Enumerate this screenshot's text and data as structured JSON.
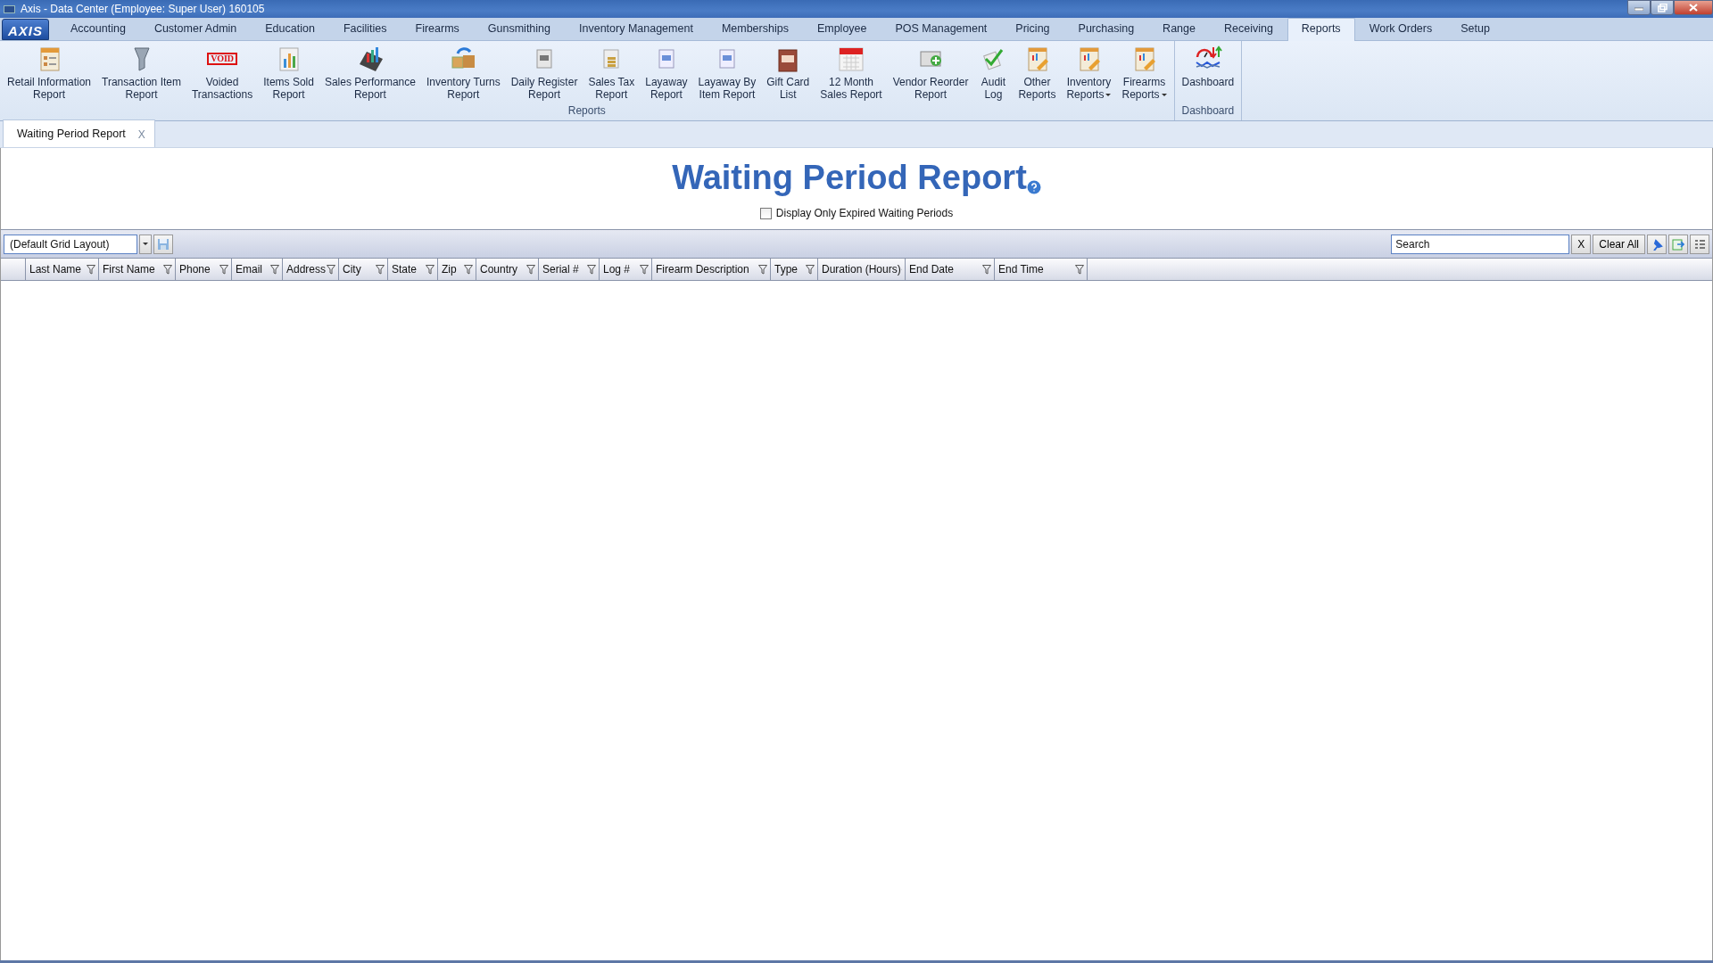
{
  "window": {
    "title": "Axis - Data Center  (Employee: Super User) 160105",
    "logo": "AXIS"
  },
  "menu_tabs": [
    {
      "label": "Accounting",
      "selected": false
    },
    {
      "label": "Customer Admin",
      "selected": false
    },
    {
      "label": "Education",
      "selected": false
    },
    {
      "label": "Facilities",
      "selected": false
    },
    {
      "label": "Firearms",
      "selected": false
    },
    {
      "label": "Gunsmithing",
      "selected": false
    },
    {
      "label": "Inventory Management",
      "selected": false
    },
    {
      "label": "Memberships",
      "selected": false
    },
    {
      "label": "Employee",
      "selected": false
    },
    {
      "label": "POS Management",
      "selected": false
    },
    {
      "label": "Pricing",
      "selected": false
    },
    {
      "label": "Purchasing",
      "selected": false
    },
    {
      "label": "Range",
      "selected": false
    },
    {
      "label": "Receiving",
      "selected": false
    },
    {
      "label": "Reports",
      "selected": true
    },
    {
      "label": "Work Orders",
      "selected": false
    },
    {
      "label": "Setup",
      "selected": false
    }
  ],
  "ribbon_groups": [
    {
      "label": "Reports",
      "items": [
        {
          "label": [
            "Retail Information",
            "Report"
          ],
          "dropdown": false
        },
        {
          "label": [
            "Transaction Item",
            "Report"
          ],
          "dropdown": false
        },
        {
          "label": [
            "Voided",
            "Transactions"
          ],
          "icon_text": "VOID",
          "dropdown": false
        },
        {
          "label": [
            "Items Sold",
            "Report"
          ],
          "dropdown": false
        },
        {
          "label": [
            "Sales Performance",
            "Report"
          ],
          "dropdown": false
        },
        {
          "label": [
            "Inventory Turns",
            "Report"
          ],
          "dropdown": false
        },
        {
          "label": [
            "Daily Register",
            "Report"
          ],
          "dropdown": false
        },
        {
          "label": [
            "Sales Tax",
            "Report"
          ],
          "dropdown": false
        },
        {
          "label": [
            "Layaway",
            "Report"
          ],
          "dropdown": false
        },
        {
          "label": [
            "Layaway By",
            "Item Report"
          ],
          "dropdown": false
        },
        {
          "label": [
            "Gift Card",
            "List"
          ],
          "dropdown": false
        },
        {
          "label": [
            "12 Month",
            "Sales Report"
          ],
          "dropdown": false
        },
        {
          "label": [
            "Vendor Reorder",
            "Report"
          ],
          "dropdown": false
        },
        {
          "label": [
            "Audit",
            "Log"
          ],
          "dropdown": false
        },
        {
          "label": [
            "Other",
            "Reports"
          ],
          "dropdown": false
        },
        {
          "label": [
            "Inventory",
            "Reports"
          ],
          "dropdown": true
        },
        {
          "label": [
            "Firearms",
            "Reports"
          ],
          "dropdown": true
        }
      ]
    },
    {
      "label": "Dashboard",
      "items": [
        {
          "label": [
            "Dashboard"
          ],
          "dropdown": false
        }
      ]
    }
  ],
  "document_tabs": [
    {
      "label": "Waiting Period Report",
      "close": "X",
      "selected": true
    }
  ],
  "report": {
    "title": "Waiting Period Report",
    "expired_only": {
      "label": "Display Only Expired Waiting Periods",
      "checked": false
    }
  },
  "toolbar": {
    "layout": "(Default Grid Layout)",
    "search": {
      "placeholder": "Search"
    },
    "clear_search": "X",
    "clear_all": "Clear All"
  },
  "table": {
    "columns": [
      "Last Name",
      "First Name",
      "Phone",
      "Email",
      "Address",
      "City",
      "State",
      "Zip",
      "Country",
      "Serial #",
      "Log #",
      "Firearm Description",
      "Type",
      "Duration (Hours)",
      "End Date",
      "End Time"
    ]
  }
}
